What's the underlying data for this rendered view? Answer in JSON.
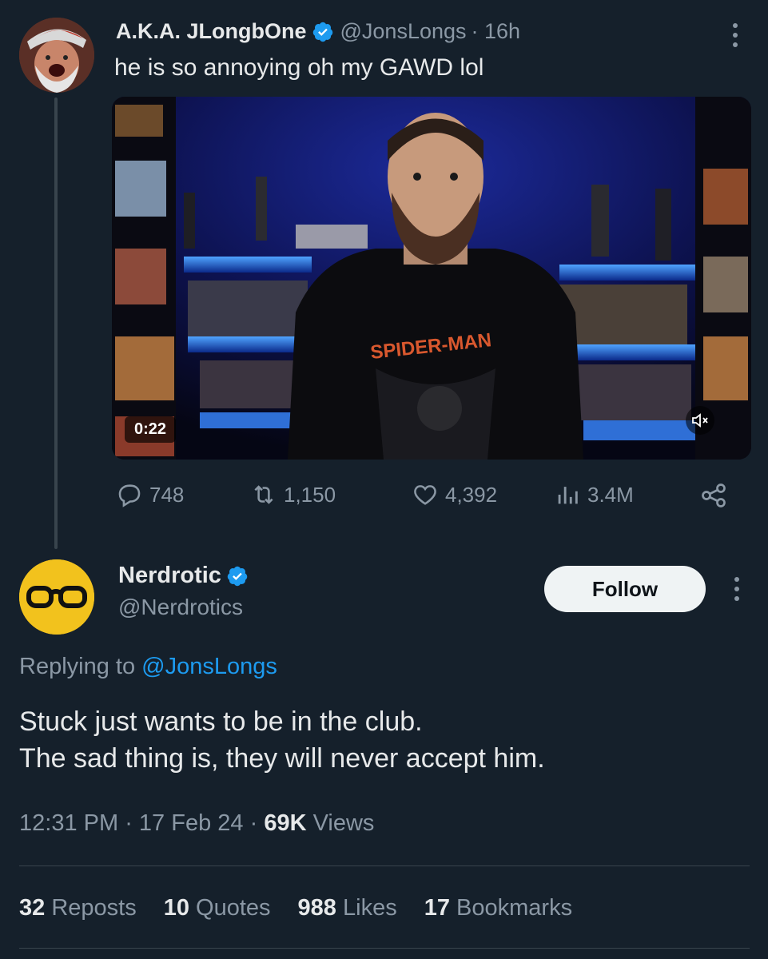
{
  "original_tweet": {
    "display_name": "A.K.A. JLongbOne",
    "handle": "@JonsLongs",
    "time": "· 16h",
    "text": "he is so annoying oh my GAWD lol",
    "media": {
      "type": "video",
      "duration": "0:22",
      "shirt_text": "SPIDER-MAN"
    },
    "actions": {
      "replies": "748",
      "reposts": "1,150",
      "likes": "4,392",
      "views": "3.4M"
    }
  },
  "reply_tweet": {
    "display_name": "Nerdrotic",
    "handle": "@Nerdrotics",
    "follow_label": "Follow",
    "replying_prefix": "Replying to",
    "replying_to": "@JonsLongs",
    "text_lines": [
      "Stuck just wants to be in the club.",
      "The sad thing is, they will never accept him."
    ],
    "time": "12:31 PM",
    "date": "17 Feb 24",
    "views_count": "69K",
    "views_label": "Views",
    "stats": [
      {
        "count": "32",
        "label": "Reposts"
      },
      {
        "count": "10",
        "label": "Quotes"
      },
      {
        "count": "988",
        "label": "Likes"
      },
      {
        "count": "17",
        "label": "Bookmarks"
      }
    ]
  },
  "colors": {
    "background": "#15202b",
    "text": "#e7e9ea",
    "secondary": "#8b98a5",
    "link": "#1d9bf0",
    "verified": "#1d9bf0",
    "follow_bg": "#eff3f4"
  },
  "icons": [
    "verified-icon",
    "more-icon",
    "reply-icon",
    "repost-icon",
    "like-icon",
    "views-icon",
    "share-icon",
    "mute-icon"
  ]
}
